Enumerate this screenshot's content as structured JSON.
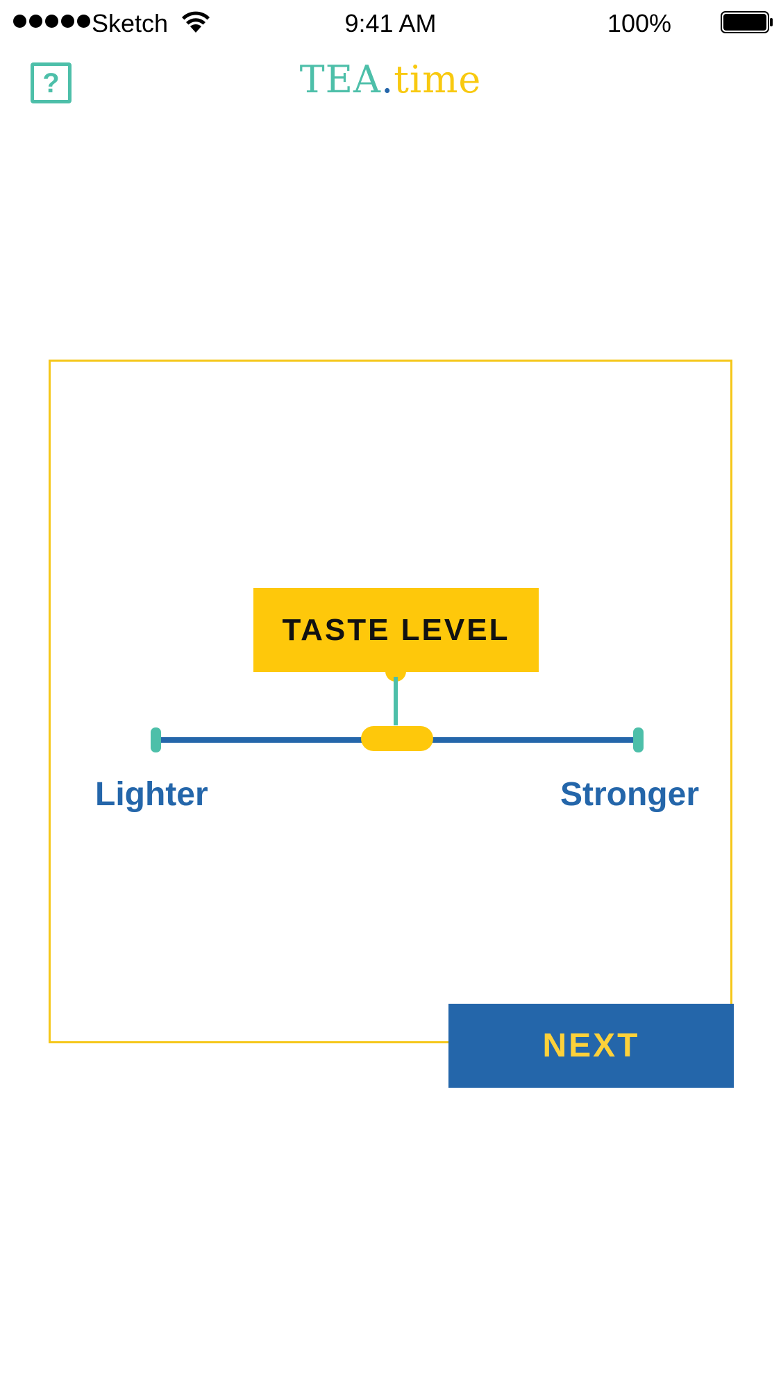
{
  "status_bar": {
    "carrier": "Sketch",
    "time": "9:41 AM",
    "battery": "100%",
    "signal_bars": 5,
    "icons": [
      "signal-icon",
      "wifi-icon",
      "battery-icon"
    ]
  },
  "header": {
    "help_label": "?",
    "brand_part1": "TEA",
    "brand_dot": ".",
    "brand_part2": "time"
  },
  "taste": {
    "title": "TASTE LEVEL",
    "min_label": "Lighter",
    "max_label": "Stronger",
    "value": 0.5
  },
  "next_label": "NEXT",
  "colors": {
    "teal": "#4dbfa9",
    "blue": "#2466aa",
    "yellow": "#fec80b",
    "frame": "#f5c71a"
  }
}
